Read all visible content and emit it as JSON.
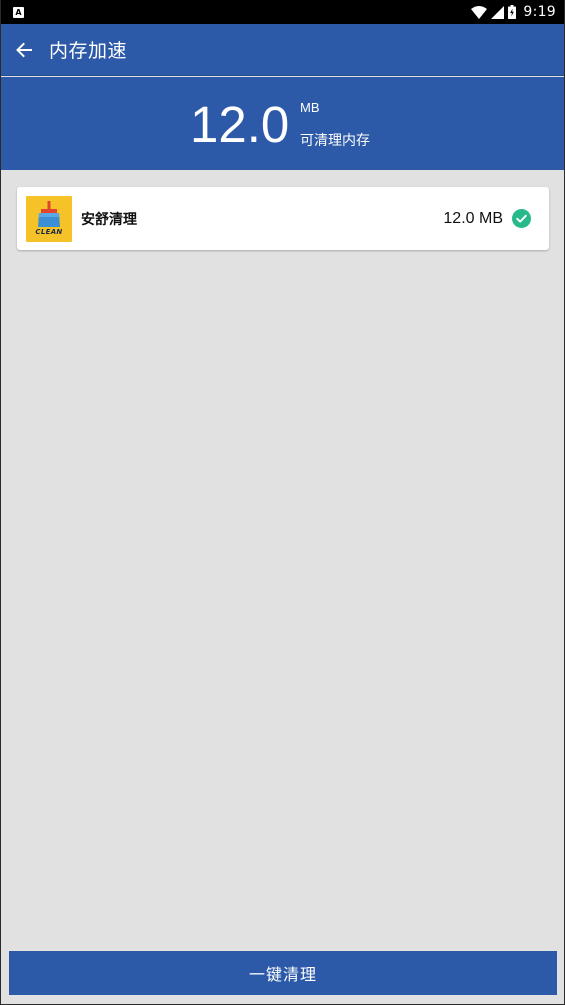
{
  "status_bar": {
    "notification_icon": "A",
    "time": "9:19",
    "icons": [
      "wifi-icon",
      "signal-icon",
      "battery-icon"
    ]
  },
  "app_bar": {
    "title": "内存加速",
    "back_icon": "arrow-left-icon"
  },
  "summary": {
    "amount": "12.0",
    "unit": "MB",
    "label": "可清理内存"
  },
  "items": [
    {
      "name": "安舒清理",
      "size": "12.0 MB",
      "icon_text": "CLEAN",
      "checked": true
    }
  ],
  "actions": {
    "clean_button": "一键清理"
  },
  "colors": {
    "primary": "#2c5aa9",
    "background": "#e1e1e1",
    "check": "#26b98a",
    "icon_bg": "#f5c327"
  }
}
